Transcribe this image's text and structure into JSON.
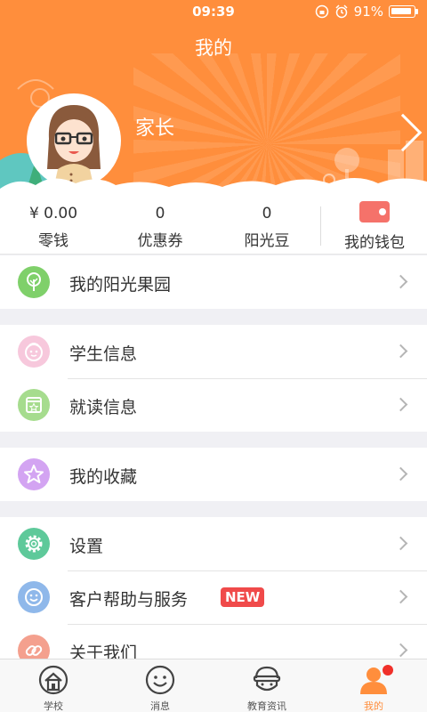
{
  "status": {
    "time": "09:39",
    "battery": "91%"
  },
  "header": {
    "title": "我的",
    "username": "家长"
  },
  "wallet": {
    "stats": [
      {
        "value": "¥ 0.00",
        "label": "零钱"
      },
      {
        "value": "0",
        "label": "优惠券"
      },
      {
        "value": "0",
        "label": "阳光豆"
      }
    ],
    "my_wallet_label": "我的钱包"
  },
  "menu": {
    "orchard": "我的阳光果园",
    "student_info": "学生信息",
    "enrollment_info": "就读信息",
    "favorites": "我的收藏",
    "settings": "设置",
    "help": "客户帮助与服务",
    "help_badge": "NEW",
    "about": "关于我们"
  },
  "icons": {
    "orchard": "tree-icon",
    "student_info": "face-icon",
    "enrollment_info": "calendar-star-icon",
    "favorites": "star-icon",
    "settings": "gear-icon",
    "help": "smile-icon",
    "about": "link-icon"
  },
  "tabs": [
    {
      "label": "学校",
      "icon": "school-icon"
    },
    {
      "label": "消息",
      "icon": "message-icon"
    },
    {
      "label": "教育资讯",
      "icon": "news-icon"
    },
    {
      "label": "我的",
      "icon": "profile-icon"
    }
  ],
  "colors": {
    "brand": "#ff8e3c",
    "badge": "#f04a4a"
  }
}
